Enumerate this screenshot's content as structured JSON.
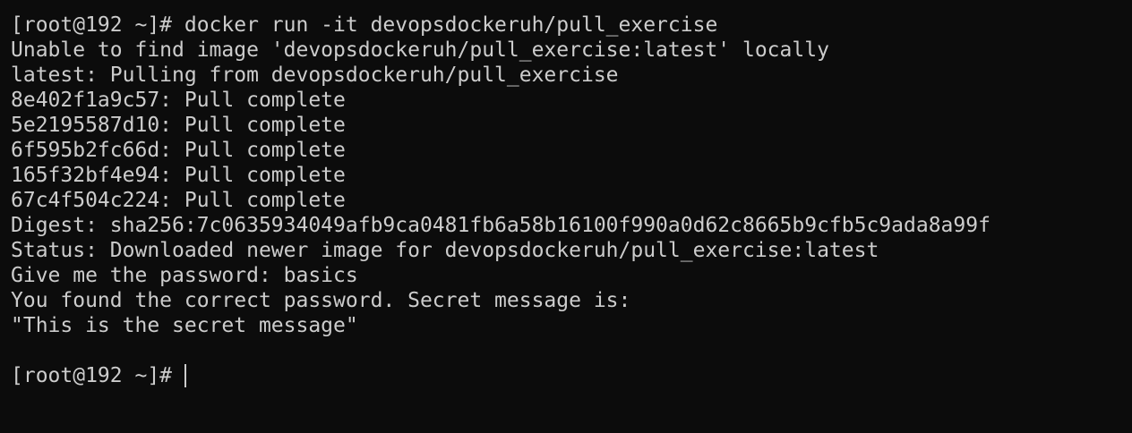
{
  "terminal": {
    "lines": [
      "[root@192 ~]# docker run -it devopsdockeruh/pull_exercise",
      "Unable to find image 'devopsdockeruh/pull_exercise:latest' locally",
      "latest: Pulling from devopsdockeruh/pull_exercise",
      "8e402f1a9c57: Pull complete",
      "5e2195587d10: Pull complete",
      "6f595b2fc66d: Pull complete",
      "165f32bf4e94: Pull complete",
      "67c4f504c224: Pull complete",
      "Digest: sha256:7c0635934049afb9ca0481fb6a58b16100f990a0d62c8665b9cfb5c9ada8a99f",
      "Status: Downloaded newer image for devopsdockeruh/pull_exercise:latest",
      "Give me the password: basics",
      "You found the correct password. Secret message is:",
      "\"This is the secret message\"",
      ""
    ],
    "prompt": "[root@192 ~]#",
    "colors": {
      "background": "#0c0c0c",
      "foreground": "#cccccc"
    }
  }
}
